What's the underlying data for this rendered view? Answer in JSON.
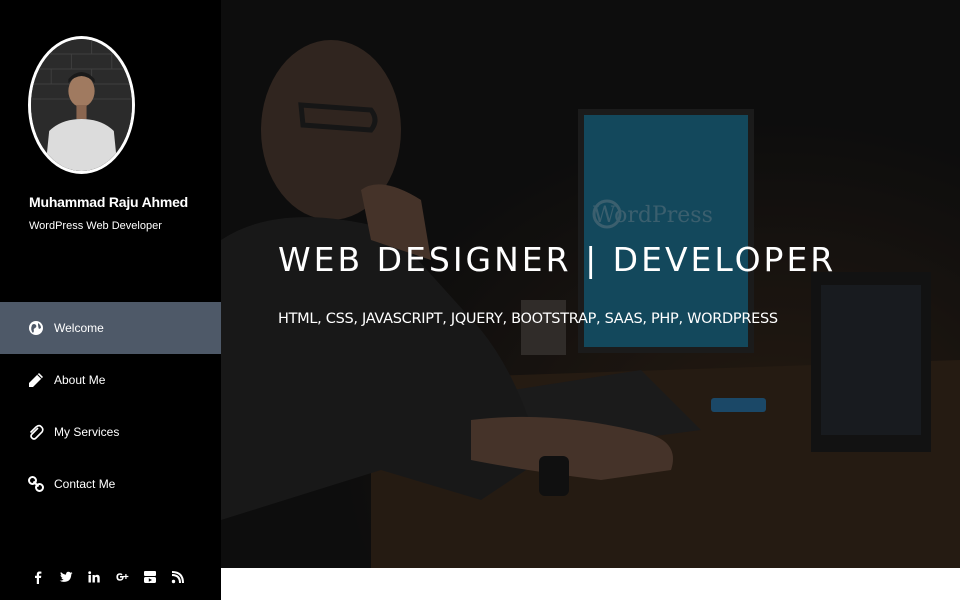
{
  "profile": {
    "name": "Muhammad Raju Ahmed",
    "role": "WordPress Web Developer"
  },
  "nav": {
    "items": [
      {
        "label": "Welcome",
        "icon": "globe-icon",
        "active": true
      },
      {
        "label": "About Me",
        "icon": "pencil-icon",
        "active": false
      },
      {
        "label": "My Services",
        "icon": "paperclip-icon",
        "active": false
      },
      {
        "label": "Contact Me",
        "icon": "link-icon",
        "active": false
      }
    ]
  },
  "social": [
    "facebook-icon",
    "twitter-icon",
    "linkedin-icon",
    "google-plus-icon",
    "youtube-icon",
    "rss-icon"
  ],
  "hero": {
    "title": "WEB DESIGNER | DEVELOPER",
    "subtitle": "HTML, CSS, JAVASCRIPT, JQUERY, BOOTSTRAP, SAAS, PHP, WORDPRESS",
    "monitor_text": "WordPress"
  },
  "colors": {
    "sidebar_bg": "#000000",
    "active_item_bg": "#4e5968",
    "monitor_blue": "#1e6f8e"
  }
}
